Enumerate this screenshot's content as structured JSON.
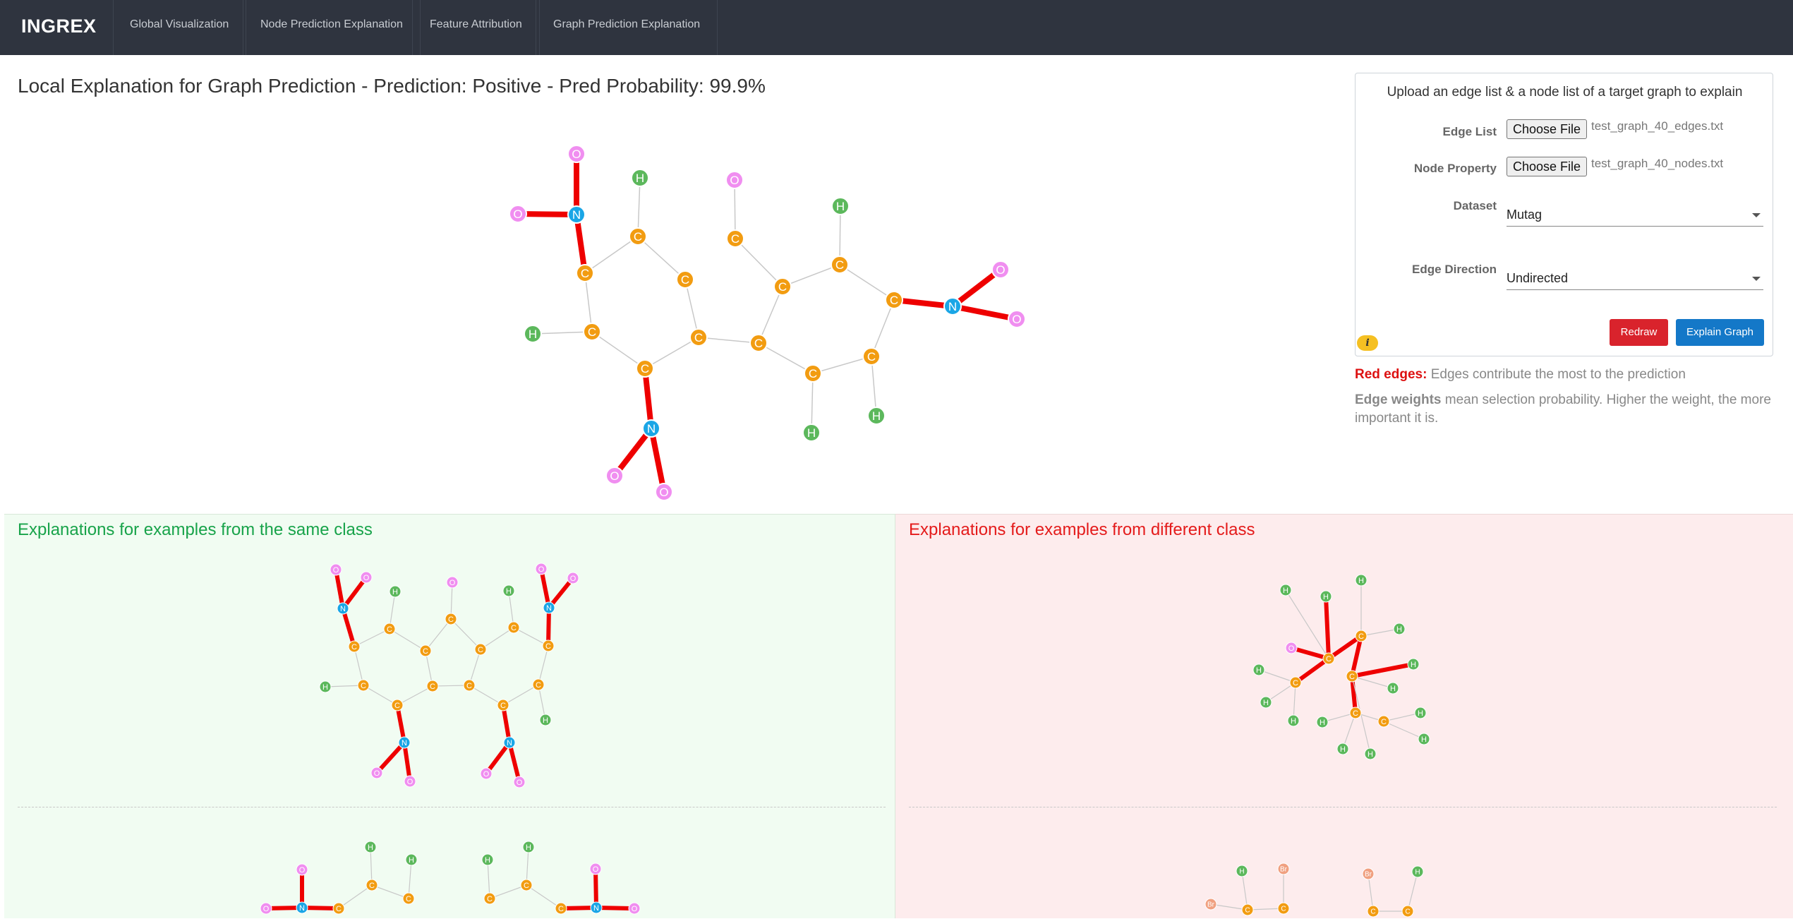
{
  "navbar": {
    "brand": "INGREX",
    "items": [
      {
        "label": "Global Visualization",
        "name": "nav-global-visualization"
      },
      {
        "label": "Node Prediction Explanation",
        "name": "nav-node-prediction-explanation"
      },
      {
        "label": "Feature Attribution",
        "name": "nav-feature-attribution"
      },
      {
        "label": "Graph Prediction Explanation",
        "name": "nav-graph-prediction-explanation"
      }
    ]
  },
  "main": {
    "title": "Local Explanation for Graph Prediction - Prediction: Positive - Pred Probability: 99.9%"
  },
  "panel": {
    "title": "Upload an edge list & a node list of a target graph to explain",
    "edge_list_label": "Edge List",
    "choose_file_label": "Choose File",
    "edge_file_name": "test_graph_40_edges.txt",
    "node_property_label": "Node Property",
    "node_file_name": "test_graph_40_nodes.txt",
    "dataset_label": "Dataset",
    "dataset_value": "Mutag",
    "edge_direction_label": "Edge Direction",
    "edge_direction_value": "Undirected",
    "redraw_label": "Redraw",
    "explain_label": "Explain Graph",
    "info_icon_glyph": "i"
  },
  "legend": {
    "red_edges_label": "Red edges:",
    "red_edges_text": " Edges contribute the most to the prediction",
    "edge_weights_label": "Edge weights",
    "edge_weights_text": " mean selection probability. Higher the weight, the more important it is."
  },
  "same_class": {
    "title": "Explanations for examples from the same class"
  },
  "diff_class": {
    "title": "Explanations for examples from different class"
  },
  "colors": {
    "navbar_bg": "#2f343f",
    "carbon": "#f29c11",
    "nitrogen": "#1aa6e6",
    "oxygen": "#f08ef0",
    "hydrogen": "#5cb85c",
    "bromine": "#f0a080",
    "important_edge": "#ee0000",
    "normal_edge": "#c8c8c8",
    "same_class_title": "#18a34a",
    "diff_class_title": "#e41b1b",
    "redraw_button": "#d9232c",
    "explain_button": "#1478c8"
  },
  "graphs": {
    "main": {
      "nodes": [
        [
          "n1",
          "O"
        ],
        [
          "n2",
          "O"
        ],
        [
          "n3",
          "N"
        ],
        [
          "n4",
          "H"
        ],
        [
          "n5",
          "O"
        ],
        [
          "n6",
          "H"
        ],
        [
          "n7",
          "C"
        ],
        [
          "n8",
          "C"
        ],
        [
          "n9",
          "C"
        ],
        [
          "n10",
          "C"
        ],
        [
          "n11",
          "C"
        ],
        [
          "n12",
          "C"
        ],
        [
          "n13",
          "C"
        ],
        [
          "n14",
          "O"
        ],
        [
          "n15",
          "N"
        ],
        [
          "n16",
          "O"
        ],
        [
          "n17",
          "H"
        ],
        [
          "n18",
          "C"
        ],
        [
          "n19",
          "C"
        ],
        [
          "n20",
          "C"
        ],
        [
          "n21",
          "C"
        ],
        [
          "n22",
          "C"
        ],
        [
          "n23",
          "H"
        ],
        [
          "n24",
          "H"
        ],
        [
          "n25",
          "N"
        ],
        [
          "n26",
          "O"
        ],
        [
          "n27",
          "O"
        ]
      ],
      "edges": [
        [
          "n1",
          "n3",
          1
        ],
        [
          "n2",
          "n3",
          1
        ],
        [
          "n3",
          "n8",
          1
        ],
        [
          "n4",
          "n7",
          0
        ],
        [
          "n7",
          "n8",
          0
        ],
        [
          "n7",
          "n9",
          0
        ],
        [
          "n8",
          "n11",
          0
        ],
        [
          "n11",
          "n17",
          0
        ],
        [
          "n11",
          "n12",
          0
        ],
        [
          "n9",
          "n18",
          0
        ],
        [
          "n5",
          "n10",
          0
        ],
        [
          "n10",
          "n13",
          0
        ],
        [
          "n6",
          "n12",
          0
        ],
        [
          "n12",
          "n25",
          1
        ],
        [
          "n14",
          "n15",
          1
        ],
        [
          "n15",
          "n16",
          1
        ],
        [
          "n18",
          "n19",
          0
        ],
        [
          "n18",
          "n20",
          0
        ],
        [
          "n19",
          "n13",
          0
        ],
        [
          "n20",
          "n21",
          0
        ],
        [
          "n21",
          "n22",
          0
        ],
        [
          "n22",
          "n25",
          0
        ],
        [
          "n22",
          "n23",
          0
        ],
        [
          "n25",
          "n26",
          1
        ],
        [
          "n25",
          "n27",
          1
        ],
        [
          "n13",
          "n10",
          0
        ],
        [
          "n10",
          "n19",
          0
        ],
        [
          "n24",
          "n22",
          0
        ]
      ]
    }
  }
}
